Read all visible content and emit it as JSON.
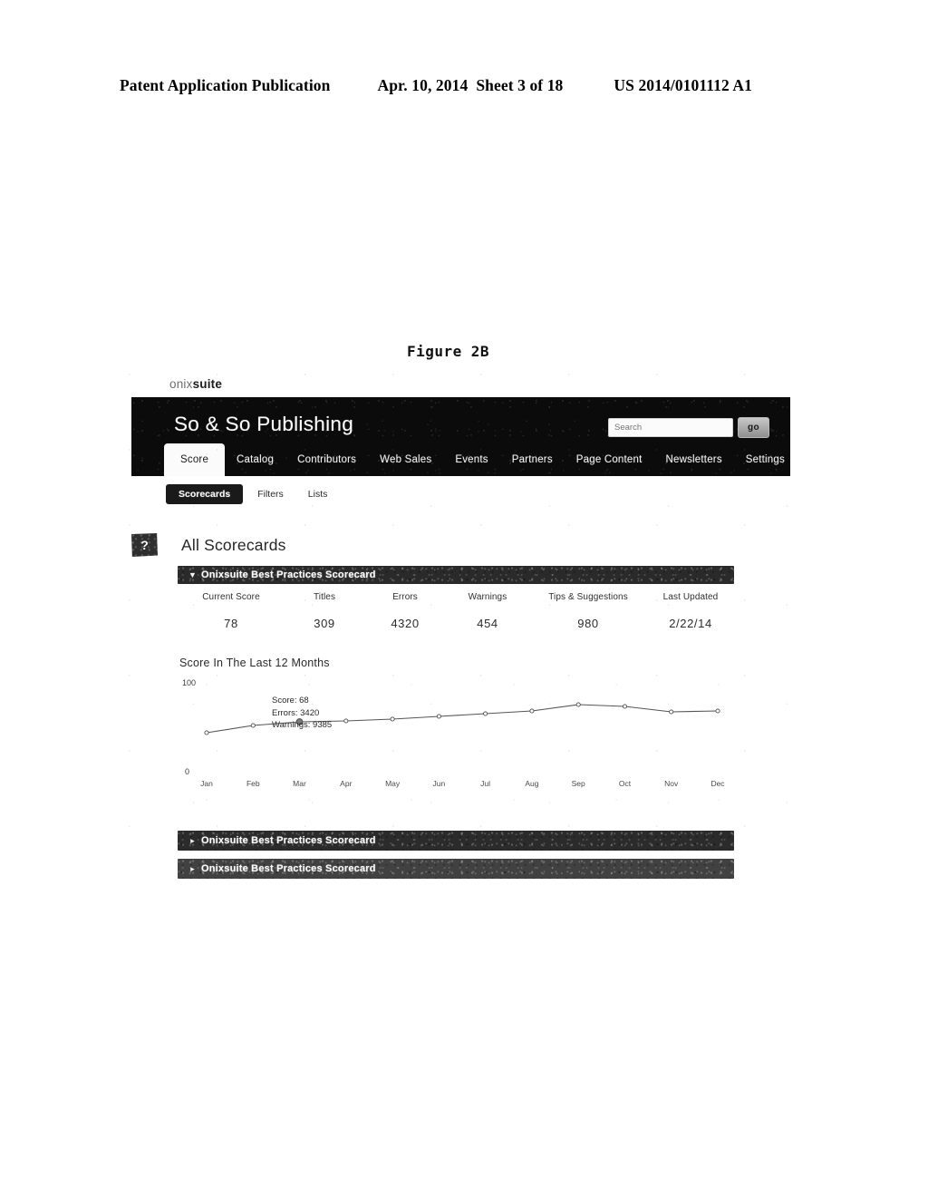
{
  "patent_header": {
    "publication": "Patent Application Publication",
    "date": "Apr. 10, 2014",
    "sheet": "Sheet 3 of 18",
    "number": "US 2014/0101112 A1"
  },
  "figure": {
    "label": "Figure",
    "number": "2B"
  },
  "app": {
    "brand_light": "onix",
    "brand_bold": "suite",
    "title": "So & So Publishing",
    "search": {
      "value": "",
      "placeholder": "Search",
      "button_label": "go"
    },
    "nav_tabs": [
      {
        "label": "Score",
        "active": true
      },
      {
        "label": "Catalog",
        "active": false
      },
      {
        "label": "Contributors",
        "active": false
      },
      {
        "label": "Web Sales",
        "active": false
      },
      {
        "label": "Events",
        "active": false
      },
      {
        "label": "Partners",
        "active": false
      },
      {
        "label": "Page Content",
        "active": false
      },
      {
        "label": "Newsletters",
        "active": false
      },
      {
        "label": "Settings",
        "active": false
      }
    ],
    "sub_nav": [
      {
        "label": "Scorecards",
        "active": true
      },
      {
        "label": "Filters",
        "active": false
      },
      {
        "label": "Lists",
        "active": false
      }
    ]
  },
  "page": {
    "help_icon_label": "?",
    "title": "All Scorecards"
  },
  "scorecards": [
    {
      "label": "Onixsuite Best Practices Scorecard",
      "expanded": true,
      "chevron": "▼"
    },
    {
      "label": "Onixsuite Best Practices Scorecard",
      "expanded": false,
      "chevron": "▸"
    },
    {
      "label": "Onixsuite Best Practices Scorecard",
      "expanded": false,
      "chevron": "▸"
    }
  ],
  "stats": {
    "headers": [
      "Current Score",
      "Titles",
      "Errors",
      "Warnings",
      "Tips & Suggestions",
      "Last Updated"
    ],
    "values": [
      "78",
      "309",
      "4320",
      "454",
      "980",
      "2/22/14"
    ]
  },
  "chart_section": {
    "title": "Score In The Last 12 Months",
    "tooltip": {
      "score": "Score: 68",
      "errors": "Errors: 3420",
      "warnings": "Warnings: 9385"
    }
  },
  "chart_data": {
    "type": "line",
    "title": "Score In The Last 12 Months",
    "xlabel": "",
    "ylabel": "",
    "ylim": [
      0,
      100
    ],
    "ytick_labels": [
      "0",
      "100"
    ],
    "grid": false,
    "legend": false,
    "categories": [
      "Jan",
      "Feb",
      "Mar",
      "Apr",
      "May",
      "Jun",
      "Jul",
      "Aug",
      "Sep",
      "Oct",
      "Nov",
      "Dec"
    ],
    "series": [
      {
        "name": "Score",
        "values": [
          42,
          50,
          54,
          55,
          57,
          60,
          63,
          66,
          73,
          71,
          65,
          66
        ]
      }
    ],
    "highlighted_point": {
      "category": "Mar",
      "score": 68,
      "errors": 3420,
      "warnings": 9385
    },
    "annotations": [
      "Score: 68",
      "Errors: 3420",
      "Warnings: 9385"
    ]
  }
}
